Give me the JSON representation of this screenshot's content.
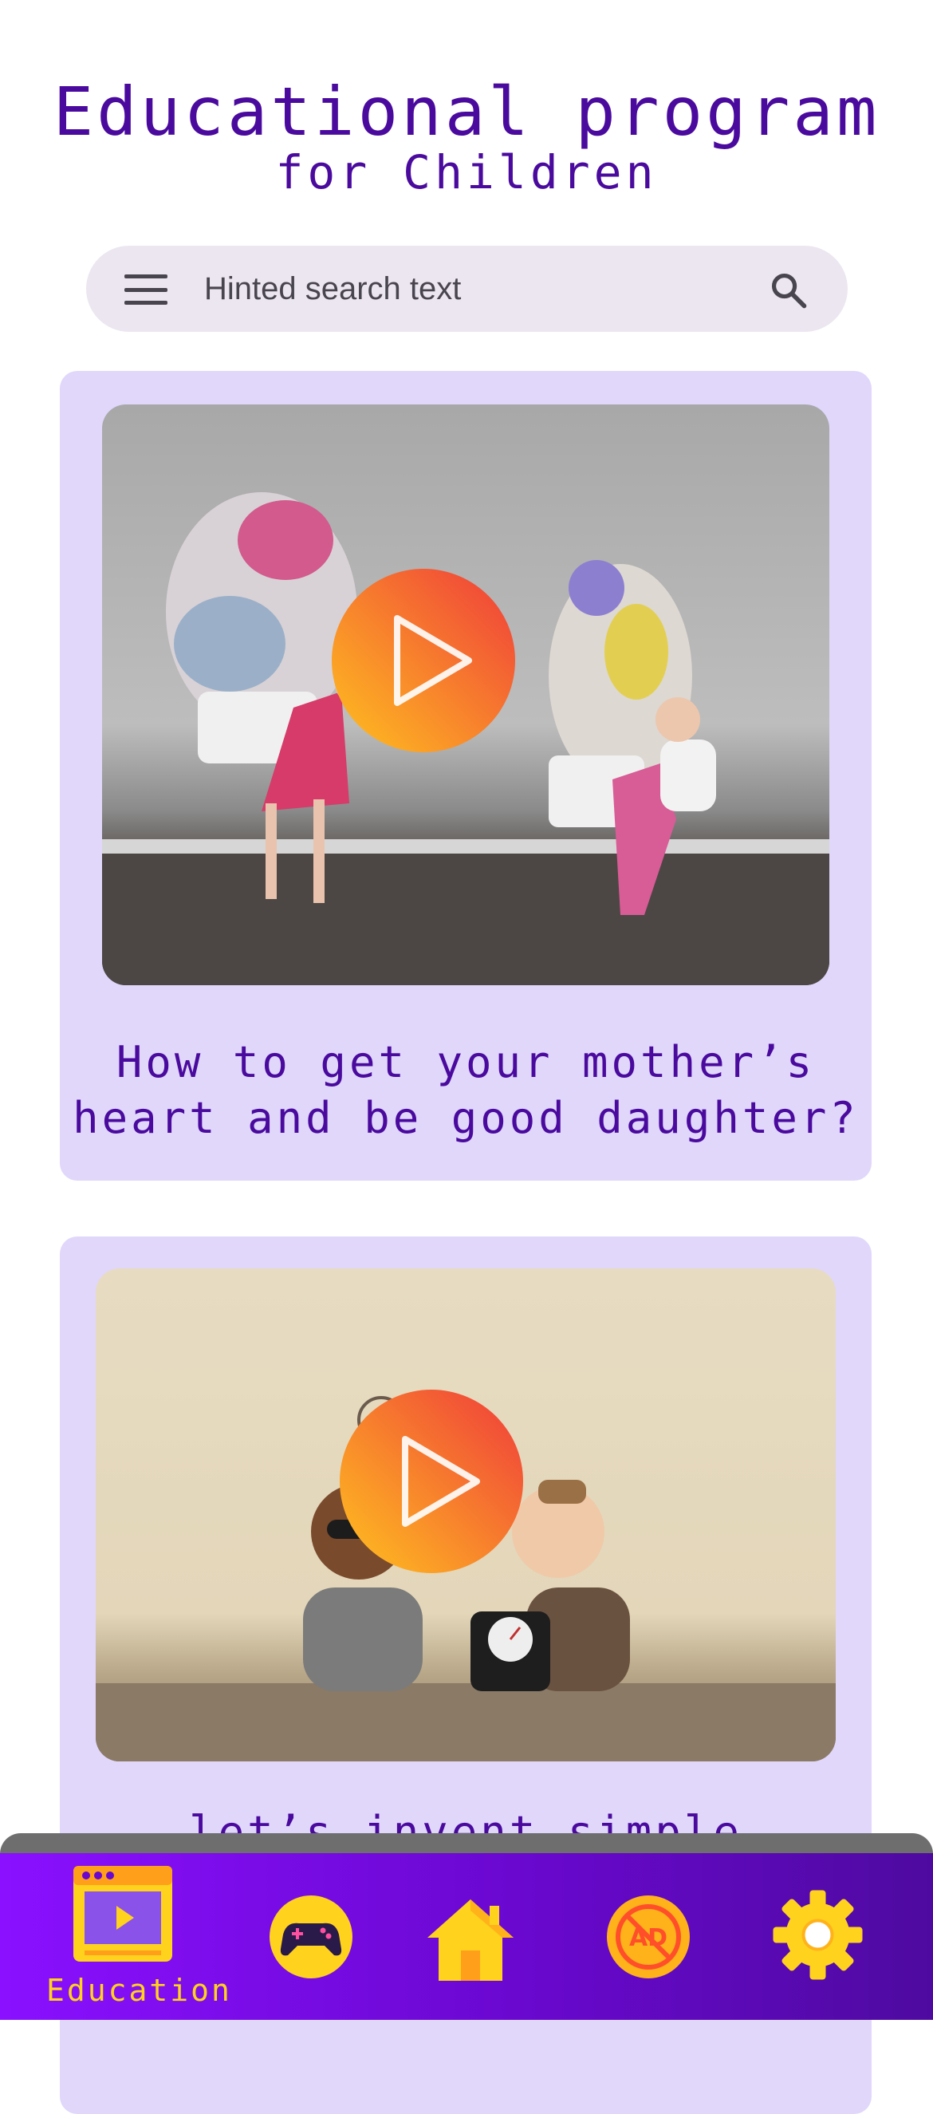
{
  "header": {
    "title": "Educational program",
    "subtitle": "for Children"
  },
  "search": {
    "placeholder": "Hinted search text",
    "menu_icon": "menu-icon",
    "search_icon": "search-icon"
  },
  "videos": [
    {
      "title_line1": "How to get your mother’s",
      "title_line2": "heart and be good daughter?"
    },
    {
      "title_line1": "let’s invent simple electric",
      "title_line2": ""
    }
  ],
  "bottom_nav": {
    "items": [
      {
        "icon": "video-education-icon",
        "label": "Education",
        "active": true
      },
      {
        "icon": "gamepad-icon",
        "label": ""
      },
      {
        "icon": "home-icon",
        "label": ""
      },
      {
        "icon": "no-ads-icon",
        "label": ""
      },
      {
        "icon": "settings-gear-icon",
        "label": ""
      }
    ]
  },
  "colors": {
    "accent": "#4a0a9e",
    "card_bg": "#e0d7fb",
    "nav_start": "#8a10ff",
    "nav_end": "#4e0aa0",
    "nav_icon": "#ffd21e",
    "play_start": "#ffb020",
    "play_end": "#f03a3a"
  }
}
